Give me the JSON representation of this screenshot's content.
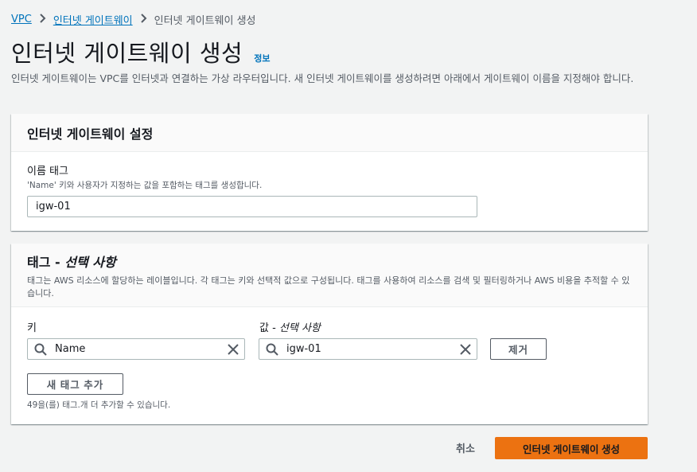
{
  "breadcrumb": {
    "items": [
      "VPC",
      "인터넷 게이트웨이"
    ],
    "current": "인터넷 게이트웨이 생성"
  },
  "page": {
    "title": "인터넷 게이트웨이 생성",
    "info_link": "정보",
    "description": "인터넷 게이트웨이는 VPC를 인터넷과 연결하는 가상 라우터입니다. 새 인터넷 게이트웨이를 생성하려면 아래에서 게이트웨이 이름을 지정해야 합니다."
  },
  "settings_panel": {
    "title": "인터넷 게이트웨이 설정",
    "name_tag_label": "이름 태그",
    "name_tag_description": "'Name' 키와 사용자가 지정하는 값을 포함하는 태그를 생성합니다.",
    "name_tag_value": "igw-01"
  },
  "tags_panel": {
    "title_main": "태그 - ",
    "title_optional": "선택 사항",
    "description": "태그는 AWS 리소스에 할당하는 레이블입니다. 각 태그는 키와 선택적 값으로 구성됩니다. 태그를 사용하여 리소스를 검색 및 필터링하거나 AWS 비용을 추적할 수 있습니다.",
    "key_label": "키",
    "value_label_main": "값 - ",
    "value_label_optional": "선택 사항",
    "key_value": "Name",
    "value_value": "igw-01",
    "remove_button": "제거",
    "add_tag_button": "새 태그 추가",
    "remaining_note": "49을(를) 태그.개 더 추가할 수 있습니다."
  },
  "footer": {
    "cancel_label": "취소",
    "submit_label": "인터넷 게이트웨이 생성"
  },
  "colors": {
    "link": "#0073bb",
    "primary_button": "#ec7211",
    "page_background": "#f2f3f3"
  },
  "icons": [
    "chevron-right-icon",
    "search-icon",
    "clear-icon"
  ]
}
